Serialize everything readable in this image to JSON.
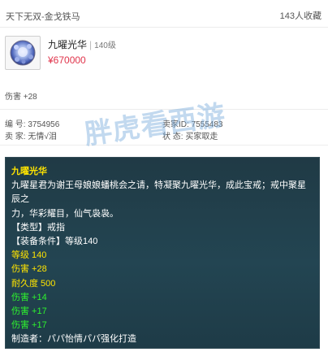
{
  "header": {
    "server": "天下无双-金戈铁马",
    "collect_count": "143人收藏"
  },
  "item": {
    "name": "九曜光华",
    "level": "140级",
    "price": "¥670000",
    "icon": "gem-orb-icon"
  },
  "summary": {
    "damage": "伤害 +28"
  },
  "info": {
    "serial_label": "编 号:",
    "serial": "3754956",
    "seller_id_label": "卖家ID:",
    "seller_id": "7555483",
    "seller_label": "卖 家:",
    "seller": "无情√泪",
    "status_label": "状 态:",
    "status": "买家取走"
  },
  "watermark": "胖虎看西游",
  "panel": {
    "title": "九曜光华",
    "desc1": "九曜星君为谢王母娘娘蟠桃会之请，特凝聚九曜光华，成此宝戒；戒中聚星辰之",
    "desc2": "力，华彩耀目，仙气袅袅。",
    "type": "【类型】戒指",
    "requirement": "【装备条件】等级140",
    "level": "等级 140",
    "damage": "伤害 +28",
    "durability": "耐久度 500",
    "bonus1": "伤害 +14",
    "bonus2": "伤害 +17",
    "bonus3": "伤害 +17",
    "maker": "制造者：パパ怡情パパ强化打造"
  },
  "colors": {
    "price": "#e0344b",
    "yellow": "#ffe400",
    "green": "#2ef22e",
    "panel_bg": "#203a45"
  }
}
